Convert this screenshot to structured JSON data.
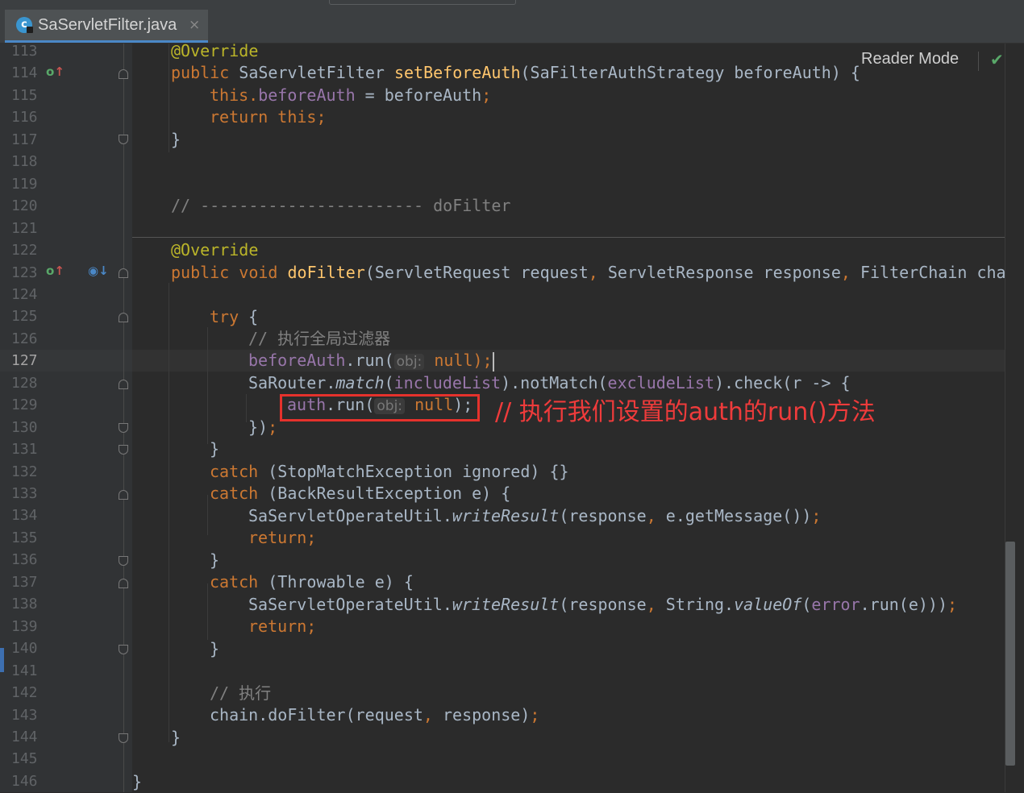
{
  "tab": {
    "filename": "SaServletFilter.java",
    "icon": "class-c-icon",
    "close": "×"
  },
  "reader_mode": {
    "label": "Reader Mode",
    "status_icon": "check-icon"
  },
  "gutter": {
    "line_numbers": [
      "113",
      "114",
      "115",
      "116",
      "117",
      "118",
      "119",
      "120",
      "121",
      "122",
      "123",
      "124",
      "125",
      "126",
      "127",
      "128",
      "129",
      "130",
      "131",
      "132",
      "133",
      "134",
      "135",
      "136",
      "137",
      "138",
      "139",
      "140",
      "141",
      "142",
      "143",
      "144",
      "145",
      "146"
    ],
    "current_line": "127"
  },
  "code": {
    "l113_ann": "@Override",
    "l114_kw": "public ",
    "l114_type": "SaServletFilter ",
    "l114_fn": "setBeforeAuth",
    "l114_rest": "(SaFilterAuthStrategy beforeAuth) {",
    "l115_kw": "this.",
    "l115_fld": "beforeAuth",
    "l115_rest": " = beforeAuth",
    "l115_semi": ";",
    "l116_kw": "return this;",
    "l117": "}",
    "l120_com": "// ----------------------- doFilter",
    "l122_ann": "@Override",
    "l123_kw": "public void ",
    "l123_fn": "doFilter",
    "l123_rest1": "(ServletRequest request",
    "l123_comma1": ",",
    "l123_rest2": " ServletResponse response",
    "l123_comma2": ",",
    "l123_rest3": " FilterChain chain",
    "l125_kw": "try",
    "l125_rest": " {",
    "l126_com": "// 执行全局过滤器",
    "l127_fld": "beforeAuth",
    "l127_run": ".run(",
    "l127_hint": "obj:",
    "l127_null": "null",
    "l127_end": ");",
    "l128_a": "SaRouter.",
    "l128_match": "match",
    "l128_b": "(",
    "l128_inc": "includeList",
    "l128_c": ").notMatch(",
    "l128_exc": "excludeList",
    "l128_d": ").check(r -> {",
    "l129_fld": "auth",
    "l129_run": ".run(",
    "l129_hint": "obj:",
    "l129_null": "null",
    "l129_end": ");",
    "l130": "})",
    "l130_semi": ";",
    "l131": "}",
    "l132_kw": "catch",
    "l132_rest": " (StopMatchException ignored) {}",
    "l133_kw": "catch",
    "l133_rest": " (BackResultException e) {",
    "l134_a": "SaServletOperateUtil.",
    "l134_it": "writeResult",
    "l134_b": "(response",
    "l134_comma": ",",
    "l134_c": " e.getMessage())",
    "l134_semi": ";",
    "l135_kw": "return;",
    "l136": "}",
    "l137_kw": "catch",
    "l137_rest": " (Throwable e) {",
    "l138_a": "SaServletOperateUtil.",
    "l138_it": "writeResult",
    "l138_b": "(response",
    "l138_comma": ",",
    "l138_c": " String.",
    "l138_it2": "valueOf",
    "l138_d": "(",
    "l138_fld": "error",
    "l138_e": ".run(e)))",
    "l138_semi": ";",
    "l139_kw": "return;",
    "l140": "}",
    "l142_com": "// 执行",
    "l143_a": "chain.doFilter(request",
    "l143_comma": ",",
    "l143_b": " response)",
    "l143_semi": ";",
    "l144": "}",
    "l146": "}"
  },
  "annotation": {
    "text": "// 执行我们设置的auth的run()方法",
    "color": "#ef3b3b"
  },
  "colors": {
    "background": "#2b2b2b",
    "keyword": "#cc7832",
    "annotation": "#bbb529",
    "function": "#ffc66d",
    "field": "#9876aa",
    "comment": "#808080",
    "text": "#a9b7c6"
  }
}
